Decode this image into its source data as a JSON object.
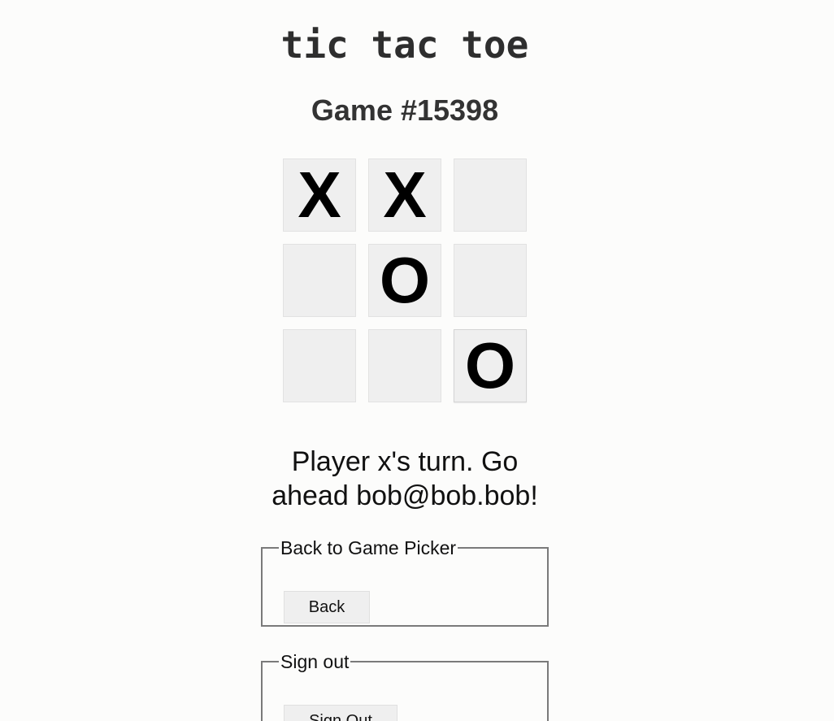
{
  "app": {
    "title": "tic tac toe"
  },
  "game": {
    "title": "Game #15398",
    "board": [
      [
        "X",
        "X",
        ""
      ],
      [
        "",
        "O",
        ""
      ],
      [
        "",
        "",
        "O"
      ]
    ],
    "status": "Player x's turn. Go ahead bob@bob.bob!"
  },
  "back_section": {
    "legend": "Back to Game Picker",
    "button_label": "Back"
  },
  "signout_section": {
    "legend": "Sign out",
    "button_label": "Sign Out"
  }
}
